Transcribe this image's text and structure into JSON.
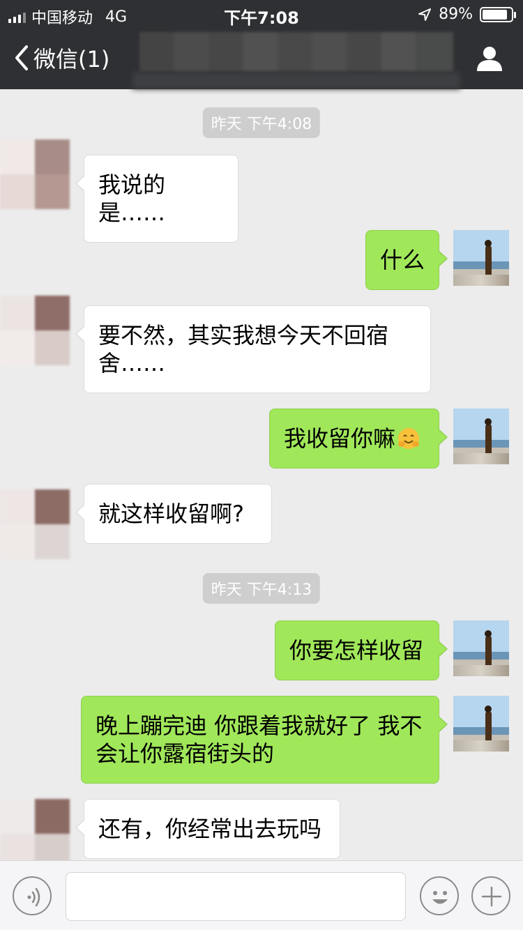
{
  "status_bar": {
    "carrier": "中国移动",
    "network": "4G",
    "time": "下午7:08",
    "battery_percent_text": "89%",
    "battery_level": 0.89
  },
  "nav": {
    "back_label": "微信(1)",
    "title": ""
  },
  "chat": {
    "time_pills": [
      "昨天 下午4:08",
      "昨天 下午4:13"
    ],
    "messages": [
      {
        "side": "in",
        "text": "我说的是……"
      },
      {
        "side": "out",
        "text": "什么"
      },
      {
        "side": "in",
        "text": "要不然，其实我想今天不回宿舍……"
      },
      {
        "side": "out",
        "text": "我收留你嘛",
        "emoji": "hugging-face"
      },
      {
        "side": "in",
        "text": "就这样收留啊?"
      },
      {
        "side": "out",
        "text": "你要怎样收留"
      },
      {
        "side": "out",
        "text": "晚上蹦完迪 你跟着我就好了 我不会让你露宿街头的"
      },
      {
        "side": "in",
        "text": "还有，你经常出去玩吗"
      }
    ]
  },
  "input_bar": {
    "value": "",
    "placeholder": ""
  },
  "colors": {
    "nav_bg": "#2f3033",
    "chat_bg": "#ececec",
    "out_bubble": "#a0e75a",
    "in_bubble": "#ffffff",
    "time_pill": "#cecece"
  },
  "icons": [
    "signal-icon",
    "location-icon",
    "battery-icon",
    "back-chevron-icon",
    "profile-icon",
    "voice-icon",
    "emoji-icon",
    "plus-icon",
    "hugging-face-emoji-icon"
  ]
}
